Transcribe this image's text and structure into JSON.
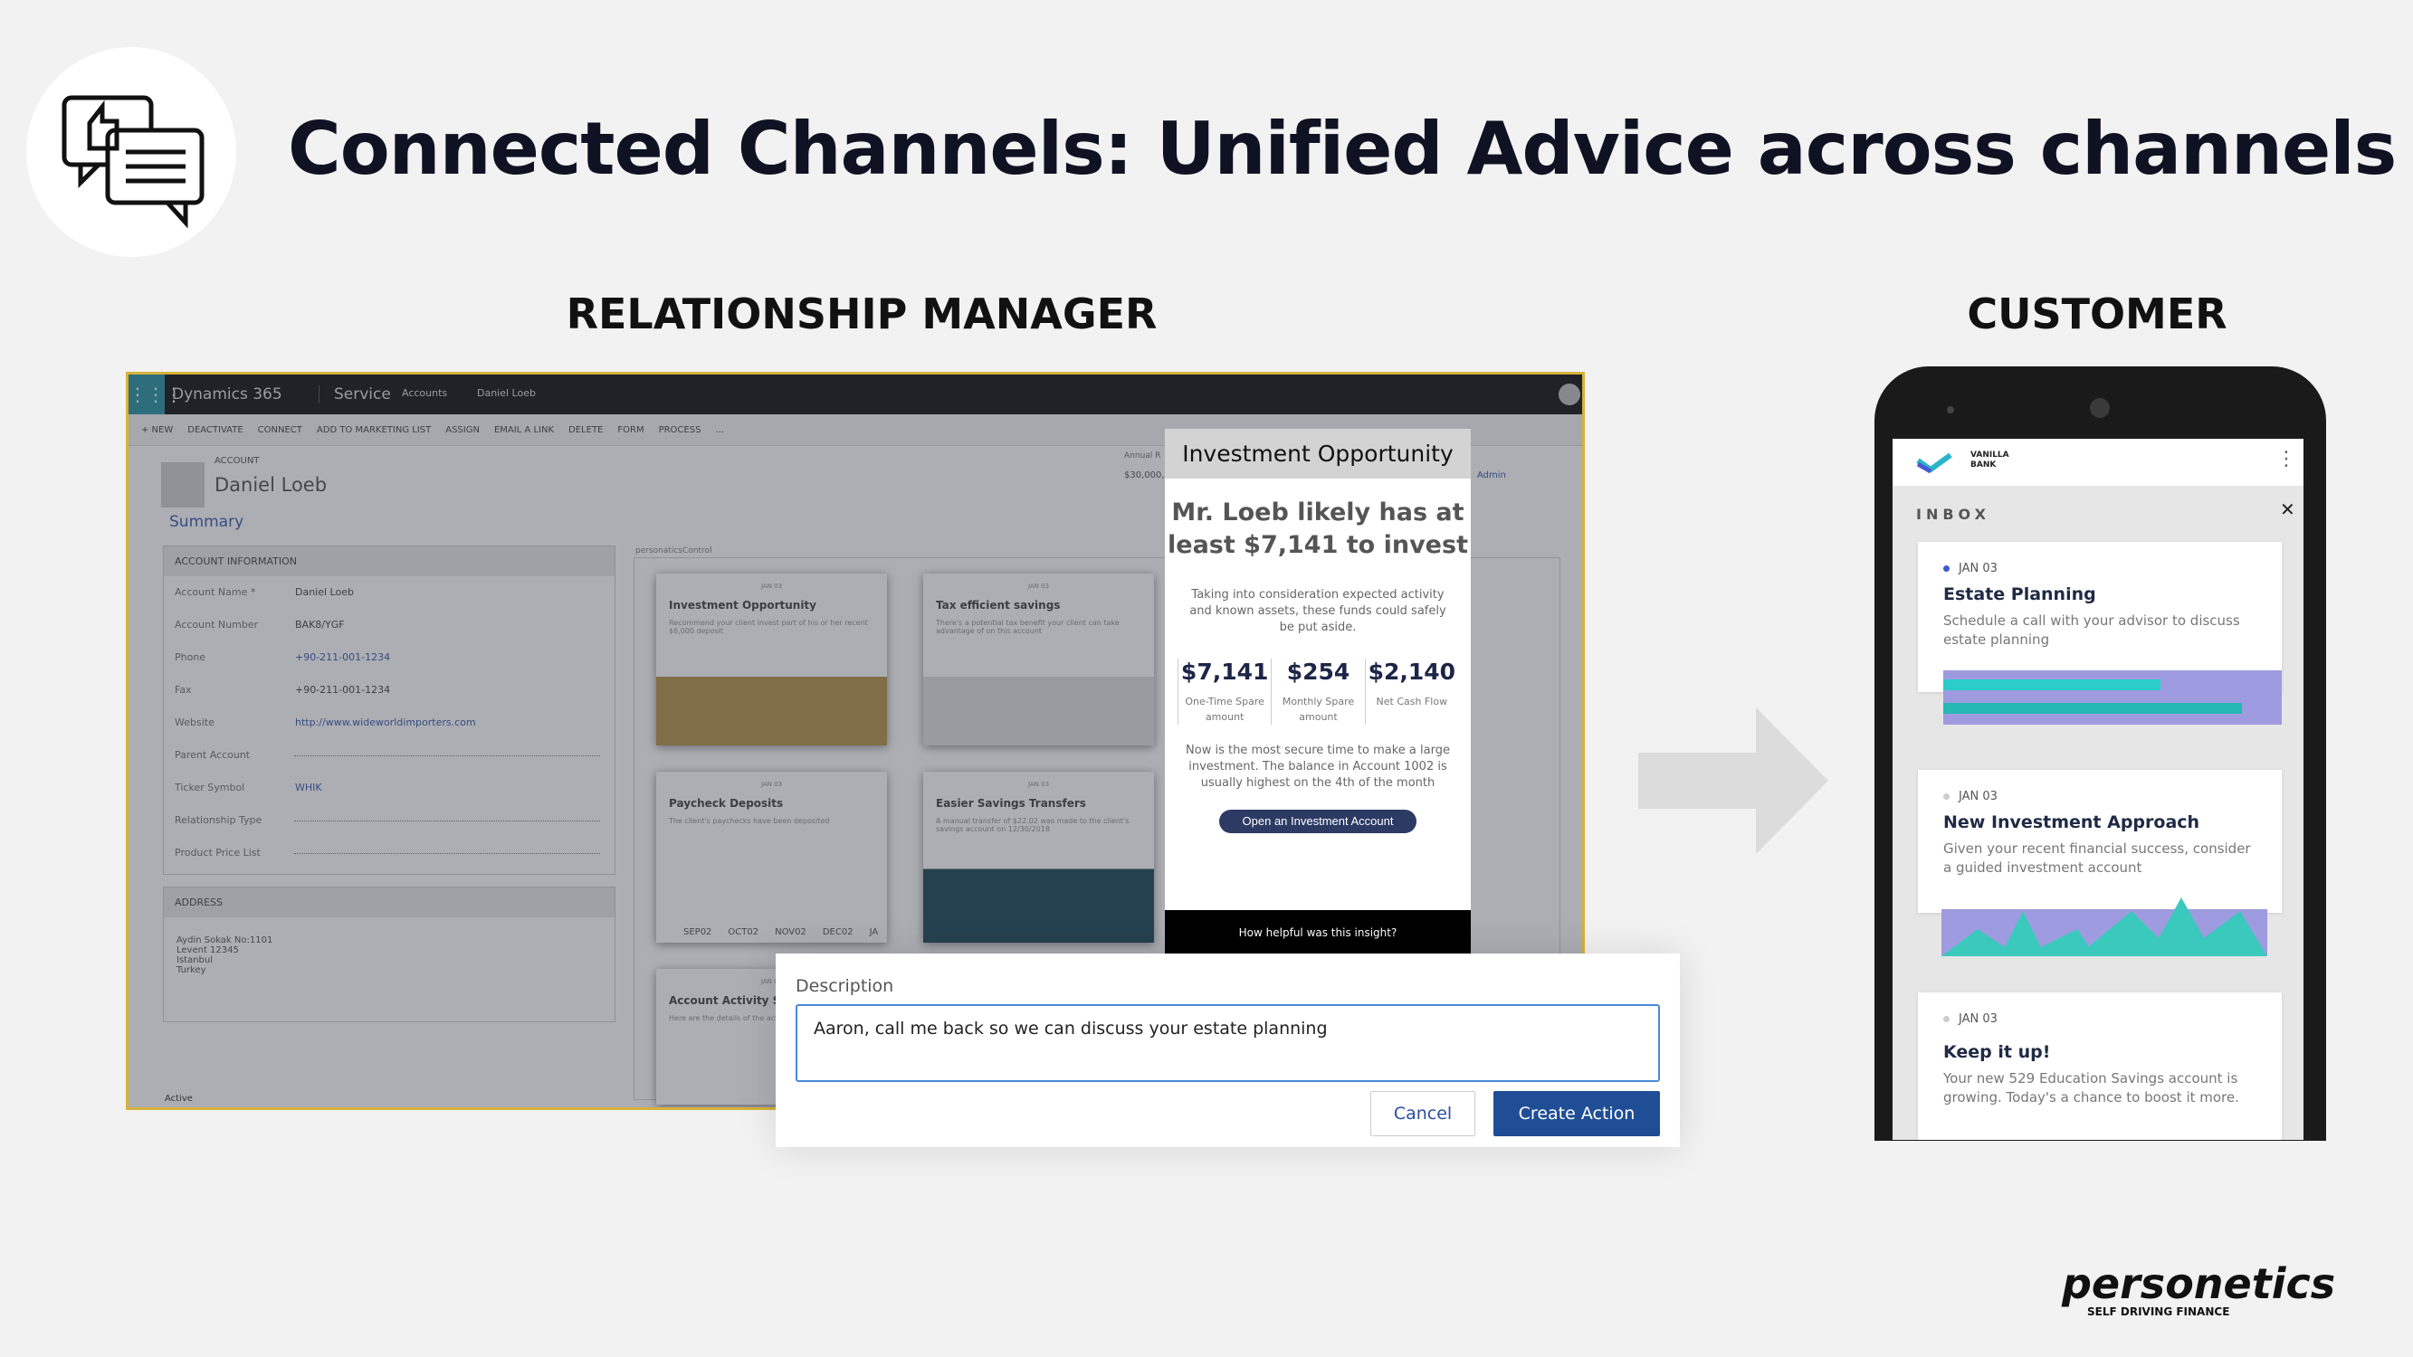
{
  "title": "Connected Channels: Unified Advice across channels",
  "sections": {
    "rm": "RELATIONSHIP MANAGER",
    "customer": "CUSTOMER"
  },
  "crm": {
    "app": "Dynamics 365",
    "module": "Service",
    "breadcrumb": [
      "Accounts",
      "Daniel Loeb"
    ],
    "toolbar": [
      "+ NEW",
      "DEACTIVATE",
      "CONNECT",
      "ADD TO MARKETING LIST",
      "ASSIGN",
      "EMAIL A LINK",
      "DELETE",
      "FORM",
      "PROCESS",
      "..."
    ],
    "entity_type": "ACCOUNT",
    "record_name": "Daniel Loeb",
    "annual_label": "Annual R",
    "annual_value": "$30,000,",
    "owner": "Admin",
    "summary": "Summary",
    "account_info": "ACCOUNT INFORMATION",
    "fields": [
      {
        "label": "Account Name *",
        "value": "Daniel Loeb"
      },
      {
        "label": "Account Number",
        "value": "BAK8/YGF"
      },
      {
        "label": "Phone",
        "value": "+90-211-001-1234",
        "link": true
      },
      {
        "label": "Fax",
        "value": "+90-211-001-1234"
      },
      {
        "label": "Website",
        "value": "http://www.wideworldimporters.com",
        "link": true
      },
      {
        "label": "Parent Account",
        "value": ""
      },
      {
        "label": "Ticker Symbol",
        "value": "WHIK",
        "link": true
      },
      {
        "label": "Relationship Type",
        "value": ""
      },
      {
        "label": "Product Price List",
        "value": ""
      }
    ],
    "address_header": "ADDRESS",
    "address": "Aydin Sokak No:1101\nLevent 12345\nIstanbul\nTurkey",
    "control_label": "personaticsControl",
    "cards": [
      {
        "date": "JAN 03",
        "title": "Investment Opportunity",
        "text": "Recommend your client invest part of his or her recent $6,000 deposit"
      },
      {
        "date": "JAN 03",
        "title": "Tax efficient savings",
        "text": "There's a potential tax benefit your client can take advantage of on this account"
      },
      {
        "date": "JAN 03",
        "title": "Paycheck Deposits",
        "text": "The client's paychecks have been deposited",
        "months": [
          "SEP02",
          "OCT02",
          "NOV02",
          "DEC02",
          "JA"
        ]
      },
      {
        "date": "JAN 03",
        "title": "Easier Savings Transfers",
        "text": "A manual transfer of $22.02 was made to the client's savings account on 12/30/2018"
      },
      {
        "date": "JAN 03",
        "title": "Account Activity Sur",
        "text": "Here are the details of the activity during December"
      }
    ],
    "status": "Active"
  },
  "insight": {
    "header": "Investment Opportunity",
    "headline": "Mr. Loeb likely has at least $7,141 to invest",
    "intro": "Taking into consideration expected activity and known assets, these funds could safely be put aside.",
    "stats": [
      {
        "value": "$7,141",
        "label": "One-Time Spare amount"
      },
      {
        "value": "$254",
        "label": "Monthly Spare amount"
      },
      {
        "value": "$2,140",
        "label": "Net Cash Flow"
      }
    ],
    "note": "Now is the most secure time to make a large investment. The balance in Account 1002 is usually highest on the 4th of the month",
    "cta": "Open an Investment Account",
    "feedback": "How helpful was this insight?"
  },
  "dialog": {
    "label": "Description",
    "value": "Aaron, call me back so we can discuss your estate planning",
    "cancel": "Cancel",
    "create": "Create Action"
  },
  "mobile": {
    "bank": "VANILLA BANK",
    "inbox": "INBOX",
    "items": [
      {
        "date": "JAN 03",
        "title": "Estate Planning",
        "text": "Schedule a call with your advisor to discuss estate planning",
        "unread": true
      },
      {
        "date": "JAN 03",
        "title": "New Investment Approach",
        "text": "Given your recent financial success, consider a guided investment account"
      },
      {
        "date": "JAN 03",
        "title": "Keep it up!",
        "text": "Your new 529 Education Savings account is growing. Today's a chance to boost it more."
      }
    ]
  },
  "brand": {
    "logo": "personetics",
    "tagline": "SELF DRIVING FINANCE"
  },
  "colors": {
    "accent": "#1f4e96",
    "navy": "#1d2547",
    "gold_border": "#d6b23a",
    "teal": "#1b8a9a"
  }
}
